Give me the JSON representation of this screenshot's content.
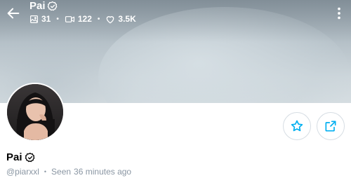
{
  "header": {
    "name": "Pai",
    "stats": {
      "photos": "31",
      "videos": "122",
      "likes": "3.5K"
    }
  },
  "profile": {
    "name": "Pai",
    "username": "@piarxxl",
    "seen_label": "Seen",
    "seen_value": "36 minutes ago"
  },
  "icons": {
    "back": "arrow-left-icon",
    "more": "more-vertical-icon",
    "verified": "verified-check-icon",
    "photos": "image-icon",
    "videos": "video-icon",
    "likes": "heart-icon",
    "favorite": "star-icon",
    "share": "share-icon"
  },
  "colors": {
    "accent": "#00aff0",
    "muted_text": "#8a96a3",
    "button_border": "#d6dde3"
  }
}
